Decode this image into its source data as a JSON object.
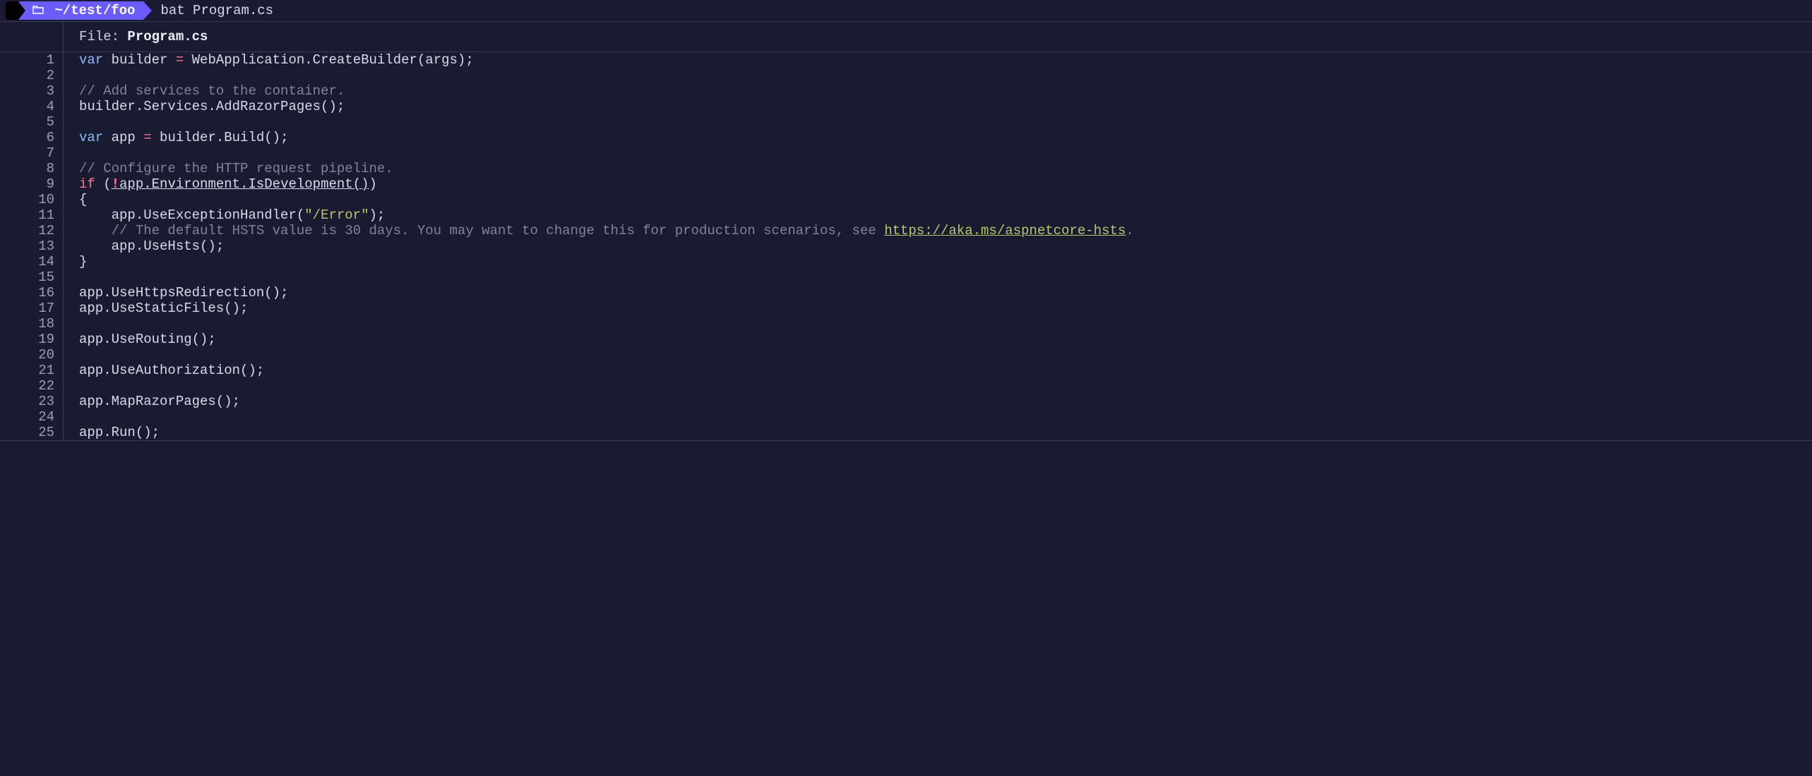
{
  "prompt": {
    "apple_icon": "",
    "folder_icon": "📂",
    "path_prefix": "~/test/",
    "path_bold": "foo",
    "command": "bat Program.cs"
  },
  "file_header": {
    "label": "File:",
    "name": "Program.cs"
  },
  "code_lines": [
    {
      "n": 1,
      "tokens": [
        [
          "kw",
          "var"
        ],
        [
          "",
          " builder "
        ],
        [
          "kwr",
          "="
        ],
        [
          "",
          " WebApplication.CreateBuilder(args);"
        ]
      ]
    },
    {
      "n": 2,
      "tokens": []
    },
    {
      "n": 3,
      "tokens": [
        [
          "cm",
          "// Add services to the container."
        ]
      ]
    },
    {
      "n": 4,
      "tokens": [
        [
          "",
          "builder.Services.AddRazorPages();"
        ]
      ]
    },
    {
      "n": 5,
      "tokens": []
    },
    {
      "n": 6,
      "tokens": [
        [
          "kw",
          "var"
        ],
        [
          "",
          " app "
        ],
        [
          "kwr",
          "="
        ],
        [
          "",
          " builder.Build();"
        ]
      ]
    },
    {
      "n": 7,
      "tokens": []
    },
    {
      "n": 8,
      "tokens": [
        [
          "cm",
          "// Configure the HTTP request pipeline."
        ]
      ]
    },
    {
      "n": 9,
      "tokens": [
        [
          "kwr",
          "if"
        ],
        [
          "",
          " ("
        ],
        [
          "neg under",
          "!"
        ],
        [
          "under",
          "app.Environment.IsDevelopment()"
        ],
        [
          "",
          ")"
        ]
      ]
    },
    {
      "n": 10,
      "tokens": [
        [
          "",
          "{"
        ]
      ]
    },
    {
      "n": 11,
      "tokens": [
        [
          "",
          "    app.UseExceptionHandler("
        ],
        [
          "str",
          "\"/Error\""
        ],
        [
          "",
          ");"
        ]
      ]
    },
    {
      "n": 12,
      "tokens": [
        [
          "cm",
          "    // The default HSTS value is 30 days. You may want to change this for production scenarios, see "
        ],
        [
          "lnk",
          "https://aka.ms/aspnetcore-hsts"
        ],
        [
          "cm",
          "."
        ]
      ]
    },
    {
      "n": 13,
      "tokens": [
        [
          "",
          "    app.UseHsts();"
        ]
      ]
    },
    {
      "n": 14,
      "tokens": [
        [
          "",
          "}"
        ]
      ]
    },
    {
      "n": 15,
      "tokens": []
    },
    {
      "n": 16,
      "tokens": [
        [
          "",
          "app.UseHttpsRedirection();"
        ]
      ]
    },
    {
      "n": 17,
      "tokens": [
        [
          "",
          "app.UseStaticFiles();"
        ]
      ]
    },
    {
      "n": 18,
      "tokens": []
    },
    {
      "n": 19,
      "tokens": [
        [
          "",
          "app.UseRouting();"
        ]
      ]
    },
    {
      "n": 20,
      "tokens": []
    },
    {
      "n": 21,
      "tokens": [
        [
          "",
          "app.UseAuthorization();"
        ]
      ]
    },
    {
      "n": 22,
      "tokens": []
    },
    {
      "n": 23,
      "tokens": [
        [
          "",
          "app.MapRazorPages();"
        ]
      ]
    },
    {
      "n": 24,
      "tokens": []
    },
    {
      "n": 25,
      "tokens": [
        [
          "",
          "app.Run();"
        ]
      ]
    }
  ]
}
